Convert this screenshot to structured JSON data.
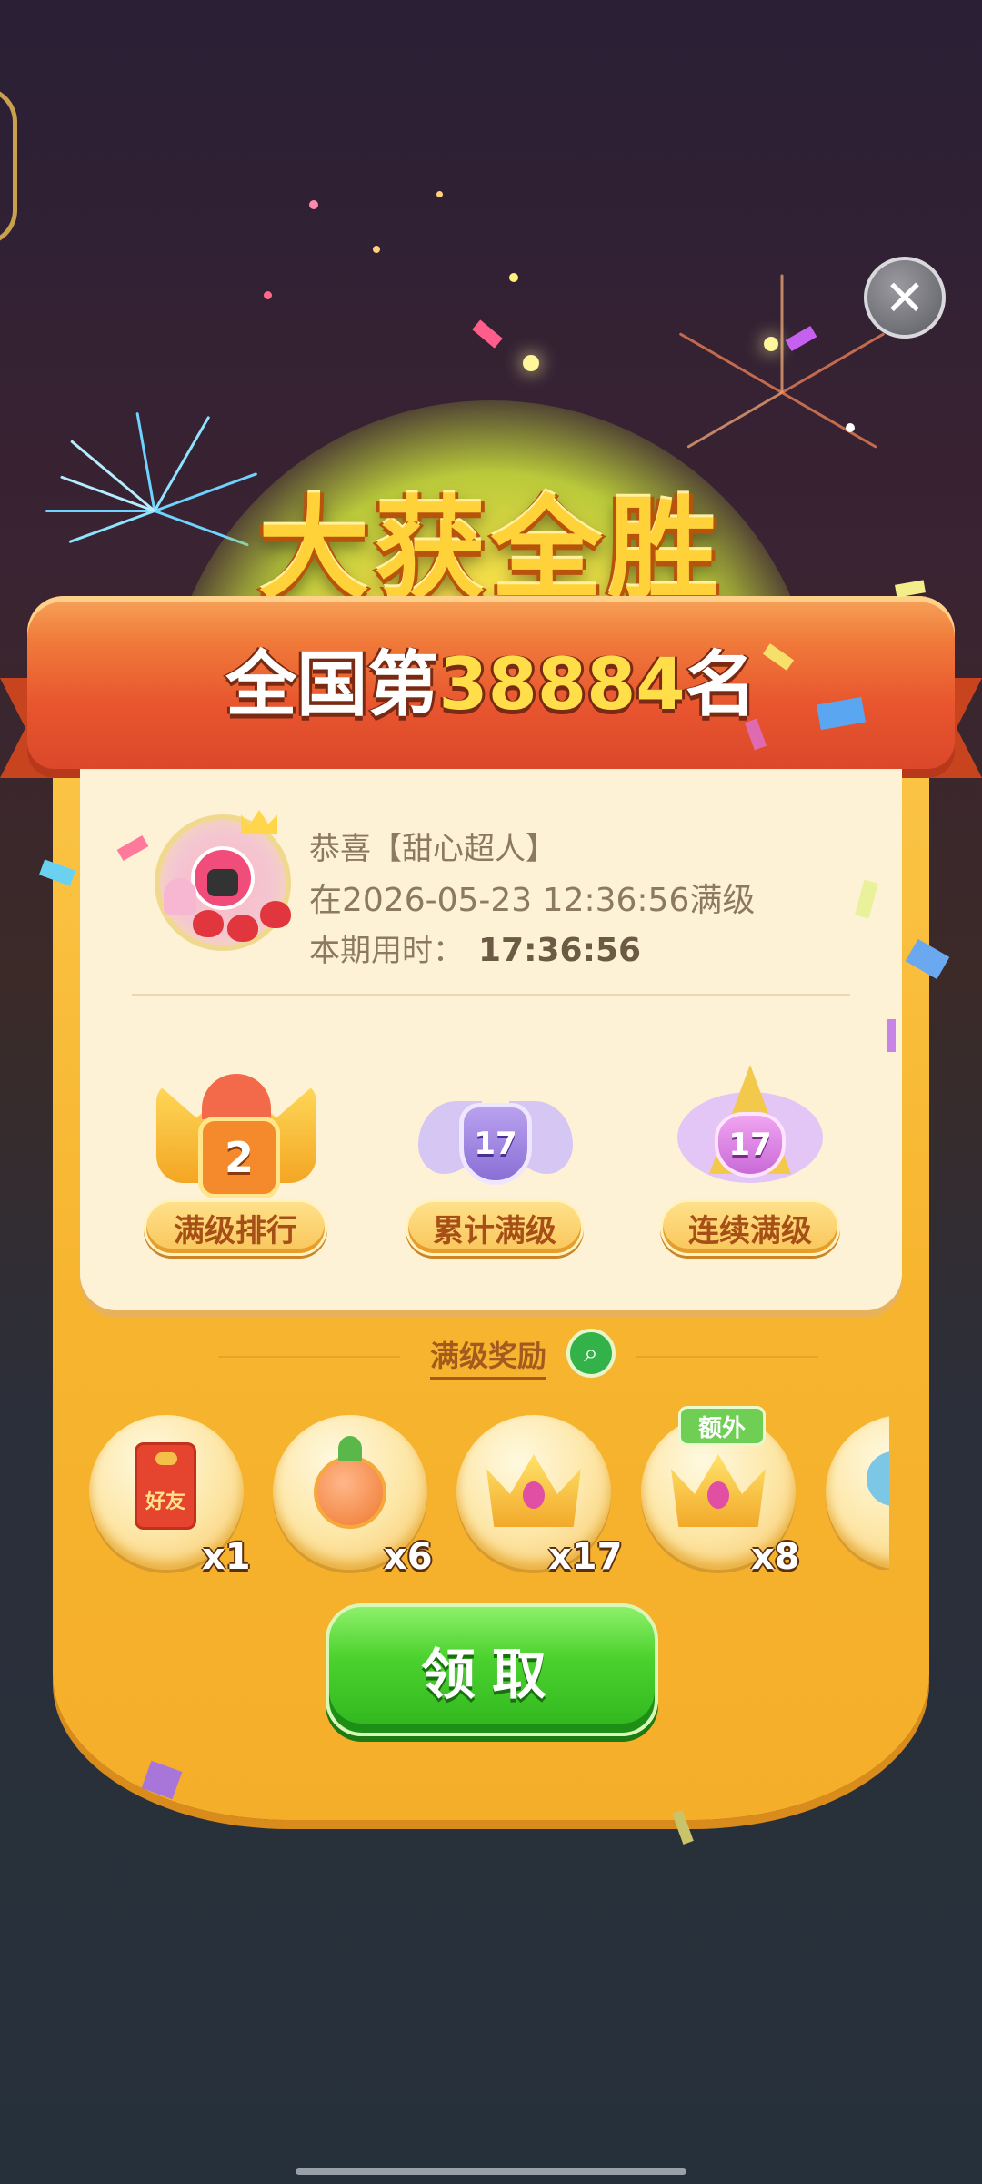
{
  "title": "大获全胜",
  "rank": {
    "prefix": "全国第",
    "number": "38884",
    "suffix": "名"
  },
  "profile": {
    "line1": "恭喜【甜心超人】",
    "line2": "在2026-05-23 12:36:56满级",
    "time_label": "本期用时：",
    "time_value": "17:36:56"
  },
  "badges": [
    {
      "label": "满级排行",
      "value": "2"
    },
    {
      "label": "累计满级",
      "value": "17"
    },
    {
      "label": "连续满级",
      "value": "17"
    }
  ],
  "rewards": {
    "title": "满级奖励",
    "items": [
      {
        "icon": "friend-red-packet-icon",
        "icon_text": "好友",
        "qty": "x1"
      },
      {
        "icon": "magic-wand-icon",
        "qty": "x6"
      },
      {
        "icon": "crown-icon",
        "qty": "x17"
      },
      {
        "icon": "crown-icon",
        "qty": "x8",
        "tag": "额外"
      },
      {
        "icon": "teapot-icon",
        "qty": ""
      }
    ]
  },
  "claim_button": "领取",
  "colors": {
    "accent_green": "#34b24a",
    "ribbon": "#e8552e",
    "rank_number": "#ffde4a",
    "card": "#f7b52f"
  }
}
